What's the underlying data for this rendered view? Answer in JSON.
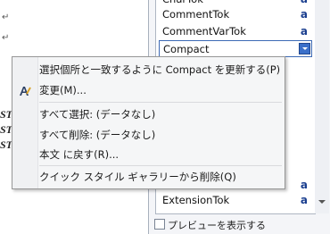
{
  "styles_pane": {
    "items": [
      {
        "name": "CharTok",
        "type": "a"
      },
      {
        "name": "CommentTok",
        "type": "a"
      },
      {
        "name": "CommentVarTok",
        "type": "a"
      },
      {
        "name": "Compact",
        "type": ""
      },
      {
        "name": "ExtensionTok",
        "type": "a"
      },
      {
        "name": "ExtensionTok",
        "type": "a"
      }
    ],
    "preview_label": "プレビューを表示する"
  },
  "document": {
    "para_mark": "↵",
    "st_text": "ST"
  },
  "context_menu": {
    "items": [
      {
        "label": "選択個所と一致するように Compact を更新する(P)"
      },
      {
        "label": "変更(M)..."
      },
      {
        "label": "すべて選択: (データなし)"
      },
      {
        "label": "すべて削除: (データなし)"
      },
      {
        "label": "本文 に戻す(R)..."
      },
      {
        "label": "クイック スタイル ギャラリーから削除(Q)"
      }
    ]
  },
  "colors": {
    "accent": "#3a6fc9",
    "type_glyph": "#1b3f8f"
  }
}
